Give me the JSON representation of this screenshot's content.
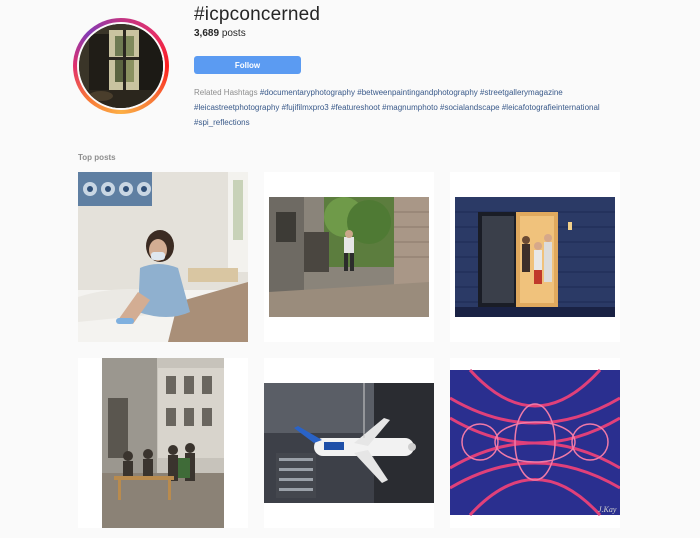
{
  "header": {
    "hashtag": "#icpconcerned",
    "post_count": "3,689",
    "posts_label": "posts",
    "follow_label": "Follow"
  },
  "related": {
    "label": "Related Hashtags",
    "tags": [
      "#documentaryphotography",
      "#betweenpaintingandphotography",
      "#streetgallerymagazine",
      "#leicastreetphotography",
      "#fujifilmxpro3",
      "#featureshoot",
      "#magnumphoto",
      "#socialandscape",
      "#leicafotografieinternational",
      "#spi_reflections"
    ]
  },
  "top_posts": {
    "label": "Top posts",
    "posts": [
      {
        "name": "post-woman-mask-bed",
        "signature": ""
      },
      {
        "name": "post-courtyard",
        "signature": ""
      },
      {
        "name": "post-family-doorway",
        "signature": ""
      },
      {
        "name": "post-street-cafe",
        "signature": ""
      },
      {
        "name": "post-airplane-model",
        "signature": ""
      },
      {
        "name": "post-abstract-pattern",
        "signature": "J.Kay"
      }
    ]
  },
  "colors": {
    "follow_button": "#5b9bf2",
    "hashtag_link": "#3a5a8a",
    "background": "#fafafa"
  }
}
